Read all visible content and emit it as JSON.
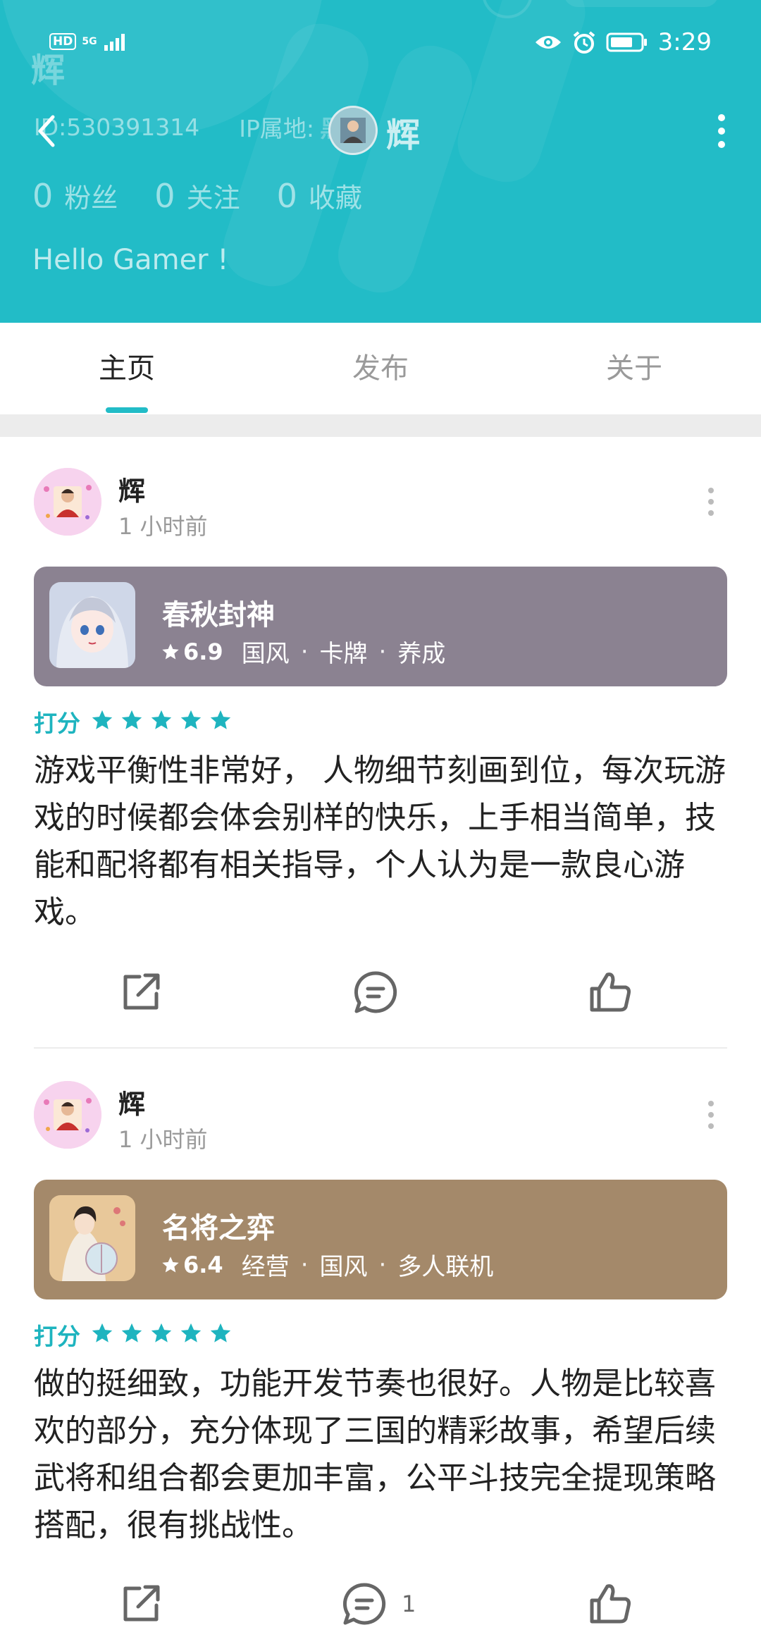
{
  "status_bar": {
    "network_badge": "HD",
    "network_type": "5G",
    "time": "3:29"
  },
  "profile": {
    "ghost_name": "辉",
    "id_text": "ID:530391314",
    "ip_label": "IP属地:",
    "ip_value": "黑龙",
    "name": "辉",
    "fans_count": "0",
    "fans_label": "粉丝",
    "follow_count": "0",
    "follow_label": "关注",
    "favorite_count": "0",
    "favorite_label": "收藏",
    "bio": "Hello Gamer !"
  },
  "tabs": [
    {
      "label": "主页",
      "active": true
    },
    {
      "label": "发布",
      "active": false
    },
    {
      "label": "关于",
      "active": false
    }
  ],
  "colors": {
    "accent": "#22bcc7",
    "rating": "#1eb4bf"
  },
  "posts": [
    {
      "author": "辉",
      "time": "1 小时前",
      "game": {
        "name": "春秋封神",
        "score": "6.9",
        "tags": [
          "国风",
          "卡牌",
          "养成"
        ],
        "card_color": "#8b8291"
      },
      "rating_label": "打分",
      "stars": 5,
      "text": "游戏平衡性非常好， 人物细节刻画到位，每次玩游戏的时候都会体会别样的快乐，上手相当简单，技能和配将都有相关指导，个人认为是一款良心游戏。",
      "comment_count": ""
    },
    {
      "author": "辉",
      "time": "1 小时前",
      "game": {
        "name": "名将之弈",
        "score": "6.4",
        "tags": [
          "经营",
          "国风",
          "多人联机"
        ],
        "card_color": "#a4896a"
      },
      "rating_label": "打分",
      "stars": 5,
      "text": "做的挺细致，功能开发节奏也很好。人物是比较喜欢的部分，充分体现了三国的精彩故事，希望后续武将和组合都会更加丰富，公平斗技完全提现策略搭配，很有挑战性。",
      "comment_count": "1"
    }
  ]
}
